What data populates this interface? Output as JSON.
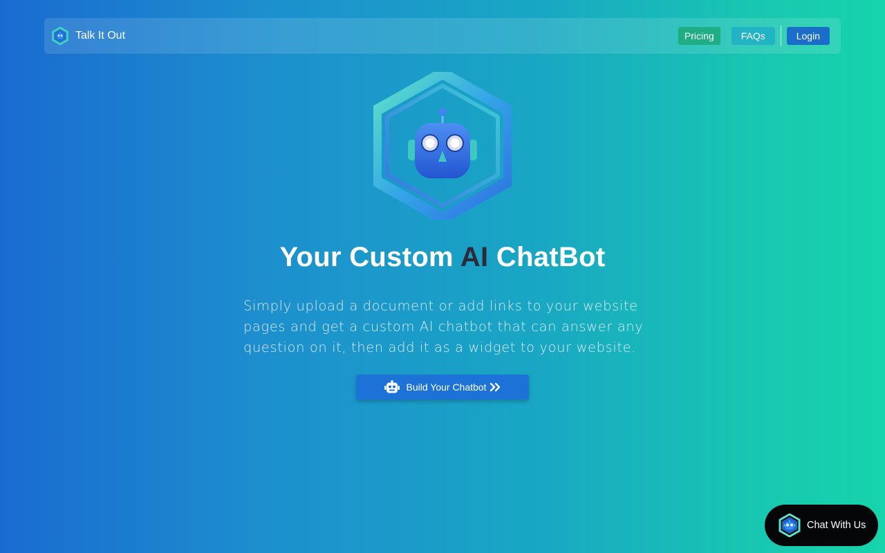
{
  "navbar": {
    "brand_name": "Talk It Out",
    "links": {
      "pricing": "Pricing",
      "faqs": "FAQs",
      "login": "Login"
    }
  },
  "hero": {
    "headline_part1": "Your Custom ",
    "headline_accent": "AI",
    "headline_part2": " ChatBot",
    "description": "Simply upload a document or add links to your website pages and get a custom AI chatbot that can answer any question on it, then add it as a widget to your website.",
    "cta_label": "Build Your Chatbot"
  },
  "chat_widget": {
    "label": "Chat With Us"
  },
  "icons": {
    "brand": "hexagon-robot-logo",
    "hero": "hexagon-robot-logo",
    "cta_left": "robot-icon",
    "cta_right": "double-chevron-right-icon",
    "widget": "hexagon-robot-logo"
  },
  "colors": {
    "background_start": "#1a6bd0",
    "background_end": "#16d4ab",
    "pricing_button": "#1fae83",
    "faqs_button": "#22b3c4",
    "login_button": "#1a6ec9",
    "cta_button": "#1c72d6",
    "headline_accent": "#2b2b3a",
    "chat_widget_bg": "#050608"
  }
}
